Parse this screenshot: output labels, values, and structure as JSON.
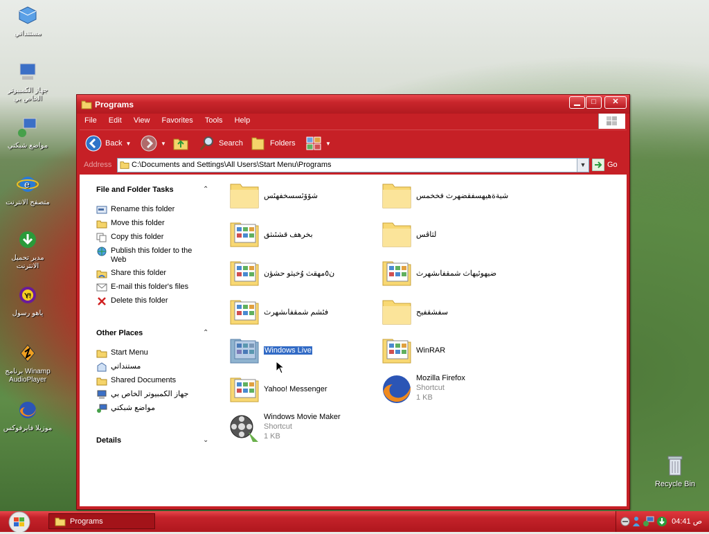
{
  "desktop": {
    "icons": [
      {
        "name": "my-documents",
        "label": "مستنداتي"
      },
      {
        "name": "my-computer",
        "label": "جهاز الكمبيوتر الخاص بي"
      },
      {
        "name": "my-network",
        "label": "مواضع شبكتي"
      },
      {
        "name": "internet-explorer",
        "label": "متصفح الانترنت"
      },
      {
        "name": "download-manager",
        "label": "مدير تحميل الانترنت"
      },
      {
        "name": "yahoo-messenger",
        "label": "ياهو رسول"
      },
      {
        "name": "winamp",
        "label": "برنامج Winamp AudioPlayer"
      },
      {
        "name": "mozilla-firefox",
        "label": "موزيلا فايرفوكس"
      }
    ],
    "recycle_bin": "Recycle Bin"
  },
  "window": {
    "title": "Programs",
    "menu": [
      "File",
      "Edit",
      "View",
      "Favorites",
      "Tools",
      "Help"
    ],
    "toolbar": {
      "back": "Back",
      "search": "Search",
      "folders": "Folders"
    },
    "address": {
      "label": "Address",
      "path": "C:\\Documents and Settings\\All Users\\Start Menu\\Programs",
      "go": "Go"
    },
    "tasks": {
      "file_folder_tasks": "File and Folder Tasks",
      "items": [
        "Rename this folder",
        "Move this folder",
        "Copy this folder",
        "Publish this folder to the Web",
        "Share this folder",
        "E-mail this folder's files",
        "Delete this folder"
      ],
      "other_places": "Other Places",
      "places": [
        "Start Menu",
        "مستنداتي",
        "Shared Documents",
        "جهاز الكمبيوتر الخاص بي",
        "مواضع شبكتي"
      ],
      "details": "Details"
    },
    "files": [
      {
        "name": "شۆۆئسسخفهئس",
        "type": "folder"
      },
      {
        "name": "شيةةهيهسفقضهرث فخخمس",
        "type": "folder"
      },
      {
        "name": "بخرهف قشئىثق",
        "type": "program"
      },
      {
        "name": "لثاڤس",
        "type": "folder"
      },
      {
        "name": "ن٥مهقث وُخيثو حشؤن",
        "type": "program"
      },
      {
        "name": "ضيهوئيهاث شمقفاىشهرث",
        "type": "program"
      },
      {
        "name": "فئشم شمقفاىشهرث",
        "type": "program"
      },
      {
        "name": "سفشقفيح",
        "type": "folder"
      },
      {
        "name": "Windows Live",
        "type": "program",
        "selected": true
      },
      {
        "name": "WinRAR",
        "type": "program"
      },
      {
        "name": "Yahoo! Messenger",
        "type": "program"
      },
      {
        "name": "Mozilla Firefox",
        "type": "firefox",
        "sub1": "Shortcut",
        "sub2": "1 KB"
      },
      {
        "name": "Windows Movie Maker",
        "type": "moviemaker",
        "sub1": "Shortcut",
        "sub2": "1 KB"
      }
    ]
  },
  "taskbar": {
    "task": "Programs",
    "clock": "04:41 ص"
  },
  "colors": {
    "theme_red": "#c62026",
    "selection": "#316ac5"
  }
}
